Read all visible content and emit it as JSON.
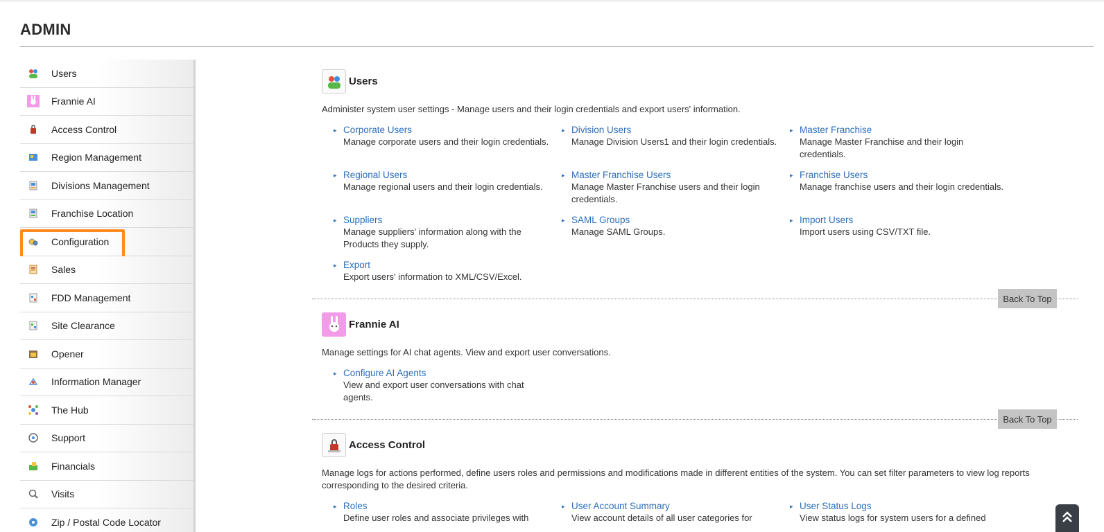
{
  "page": {
    "title": "ADMIN"
  },
  "sidebar": {
    "items": [
      {
        "label": "Users",
        "icon": "users-icon"
      },
      {
        "label": "Frannie AI",
        "icon": "frannie-ai-icon"
      },
      {
        "label": "Access Control",
        "icon": "access-control-icon"
      },
      {
        "label": "Region Management",
        "icon": "region-management-icon"
      },
      {
        "label": "Divisions Management",
        "icon": "divisions-management-icon"
      },
      {
        "label": "Franchise Location",
        "icon": "franchise-location-icon"
      },
      {
        "label": "Configuration",
        "icon": "configuration-icon",
        "highlighted": true
      },
      {
        "label": "Sales",
        "icon": "sales-icon"
      },
      {
        "label": "FDD Management",
        "icon": "fdd-management-icon"
      },
      {
        "label": "Site Clearance",
        "icon": "site-clearance-icon"
      },
      {
        "label": "Opener",
        "icon": "opener-icon"
      },
      {
        "label": "Information Manager",
        "icon": "information-manager-icon"
      },
      {
        "label": "The Hub",
        "icon": "the-hub-icon"
      },
      {
        "label": "Support",
        "icon": "support-icon"
      },
      {
        "label": "Financials",
        "icon": "financials-icon"
      },
      {
        "label": "Visits",
        "icon": "visits-icon"
      },
      {
        "label": "Zip / Postal Code Locator",
        "icon": "zip-locator-icon"
      }
    ],
    "highlight_color": "#ff8a1f"
  },
  "sections": {
    "users": {
      "title": "Users",
      "desc": "Administer system user settings - Manage users and their login credentials and export users' information.",
      "links": [
        {
          "label": "Corporate Users",
          "desc": "Manage corporate users and their login credentials."
        },
        {
          "label": "Division Users",
          "desc": "Manage Division Users1 and their login credentials."
        },
        {
          "label": "Master Franchise",
          "desc": "Manage Master Franchise and their login credentials."
        },
        {
          "label": "Regional Users",
          "desc": "Manage regional users and their login credentials."
        },
        {
          "label": "Master Franchise Users",
          "desc": "Manage Master Franchise users and their login credentials."
        },
        {
          "label": "Franchise Users",
          "desc": "Manage franchise users and their login credentials."
        },
        {
          "label": "Suppliers",
          "desc": "Manage suppliers' information along with the Products they supply."
        },
        {
          "label": "SAML Groups",
          "desc": "Manage SAML Groups."
        },
        {
          "label": "Import Users",
          "desc": "Import users using CSV/TXT file."
        },
        {
          "label": "Export",
          "desc": "Export users' information to XML/CSV/Excel."
        }
      ],
      "back_to_top": "Back To Top"
    },
    "frannie": {
      "title": "Frannie AI",
      "desc": "Manage settings for AI chat agents. View and export user conversations.",
      "links": [
        {
          "label": "Configure AI Agents",
          "desc": "View and export user conversations with chat agents."
        }
      ],
      "back_to_top": "Back To Top"
    },
    "access": {
      "title": "Access Control",
      "desc": "Manage logs for actions performed, define users roles and permissions and modifications made in different entities of the system. You can set filter parameters to view log reports corresponding to the desired criteria.",
      "links": [
        {
          "label": "Roles",
          "desc": "Define user roles and associate privileges with"
        },
        {
          "label": "User Account Summary",
          "desc": "View account details of all user categories for"
        },
        {
          "label": "User Status Logs",
          "desc": "View status logs for system users for a defined"
        }
      ]
    }
  },
  "colors": {
    "link": "#2a6ebb",
    "accent": "#ff8a1f"
  }
}
